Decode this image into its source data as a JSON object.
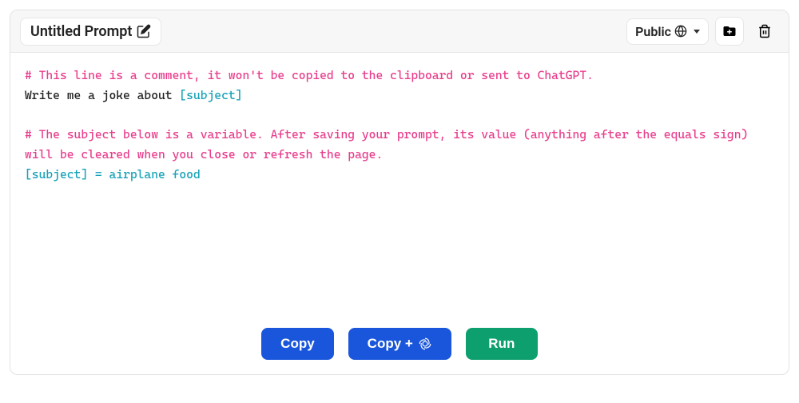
{
  "header": {
    "title": "Untitled Prompt",
    "visibility_label": "Public"
  },
  "editor": {
    "comment1": "# This line is a comment, it won't be copied to the clipboard or sent to ChatGPT.",
    "line2_pre": "Write me a joke about ",
    "line2_var": "[subject]",
    "comment2": "# The subject below is a variable. After saving your prompt, its value (anything after the equals sign) will be cleared when you close or refresh the page.",
    "line4_var": "[subject]",
    "line4_eq": " = ",
    "line4_val": "airplane food"
  },
  "footer": {
    "copy_label": "Copy",
    "copy_plus_label": "Copy +",
    "run_label": "Run"
  }
}
